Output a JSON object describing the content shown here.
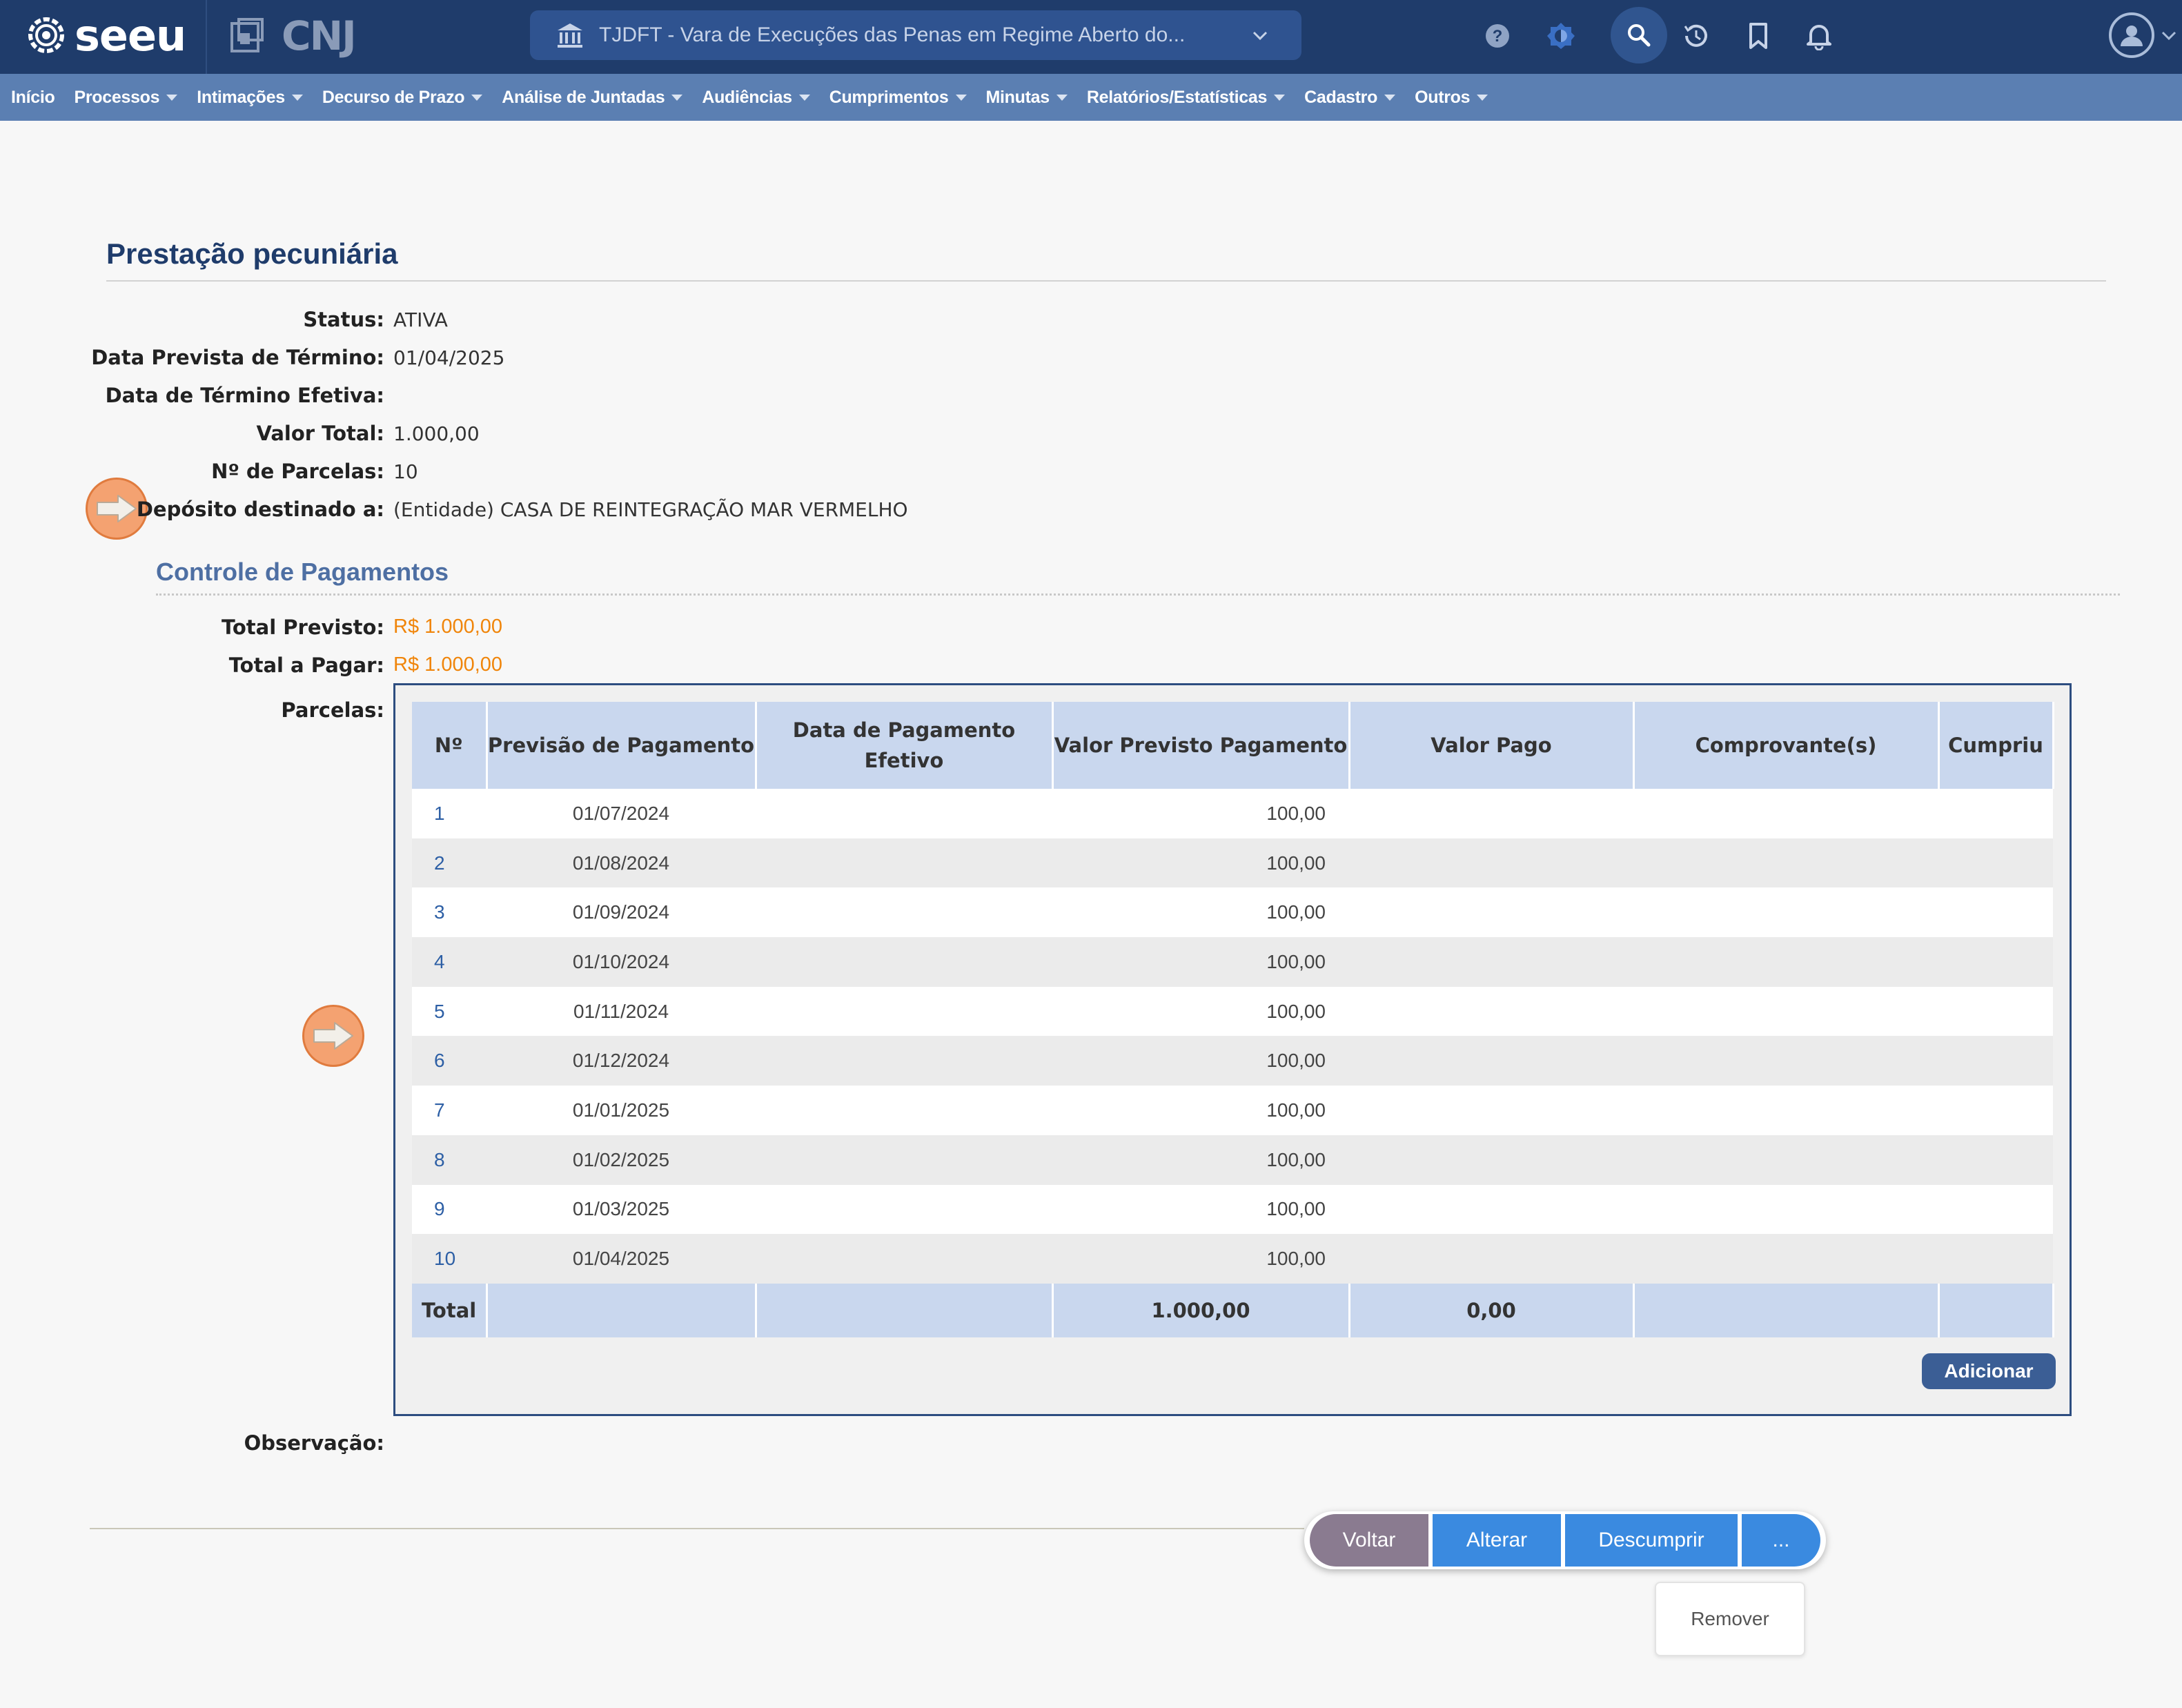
{
  "header": {
    "brand": "seeu",
    "partner_logo": "CNJ",
    "court_selector": "TJDFT - Vara de Execuções das Penas em Regime Aberto do...",
    "icons": [
      "help-icon",
      "theme-icon",
      "search-icon",
      "history-icon",
      "bookmark-icon",
      "bell-icon",
      "user-avatar-icon"
    ]
  },
  "menu": {
    "items": [
      {
        "label": "Início",
        "dropdown": false
      },
      {
        "label": "Processos",
        "dropdown": true
      },
      {
        "label": "Intimações",
        "dropdown": true
      },
      {
        "label": "Decurso de Prazo",
        "dropdown": true
      },
      {
        "label": "Análise de Juntadas",
        "dropdown": true
      },
      {
        "label": "Audiências",
        "dropdown": true
      },
      {
        "label": "Cumprimentos",
        "dropdown": true
      },
      {
        "label": "Minutas",
        "dropdown": true
      },
      {
        "label": "Relatórios/Estatísticas",
        "dropdown": true
      },
      {
        "label": "Cadastro",
        "dropdown": true
      },
      {
        "label": "Outros",
        "dropdown": true
      }
    ]
  },
  "page": {
    "title": "Prestação pecuniária",
    "fields": [
      {
        "label": "Status:",
        "value": "ATIVA"
      },
      {
        "label": "Data Prevista de Término:",
        "value": "01/04/2025"
      },
      {
        "label": "Data de Término Efetiva:",
        "value": ""
      },
      {
        "label": "Valor Total:",
        "value": "1.000,00"
      },
      {
        "label": "Nº de Parcelas:",
        "value": "10"
      },
      {
        "label": "Depósito destinado a:",
        "value": "(Entidade) CASA DE REINTEGRAÇÃO MAR VERMELHO"
      }
    ],
    "section_title": "Controle de Pagamentos",
    "totals": [
      {
        "label": "Total Previsto:",
        "value": "R$ 1.000,00"
      },
      {
        "label": "Total a Pagar:",
        "value": "R$ 1.000,00"
      }
    ],
    "parcelas_label": "Parcelas:",
    "observacao_label": "Observação:"
  },
  "table": {
    "headers": [
      "Nº",
      "Previsão de Pagamento",
      "Data de Pagamento Efetivo",
      "Valor Previsto Pagamento",
      "Valor Pago",
      "Comprovante(s)",
      "Cumpriu"
    ],
    "rows": [
      [
        "1",
        "01/07/2024",
        "",
        "100,00",
        "",
        "",
        ""
      ],
      [
        "2",
        "01/08/2024",
        "",
        "100,00",
        "",
        "",
        ""
      ],
      [
        "3",
        "01/09/2024",
        "",
        "100,00",
        "",
        "",
        ""
      ],
      [
        "4",
        "01/10/2024",
        "",
        "100,00",
        "",
        "",
        ""
      ],
      [
        "5",
        "01/11/2024",
        "",
        "100,00",
        "",
        "",
        ""
      ],
      [
        "6",
        "01/12/2024",
        "",
        "100,00",
        "",
        "",
        ""
      ],
      [
        "7",
        "01/01/2025",
        "",
        "100,00",
        "",
        "",
        ""
      ],
      [
        "8",
        "01/02/2025",
        "",
        "100,00",
        "",
        "",
        ""
      ],
      [
        "9",
        "01/03/2025",
        "",
        "100,00",
        "",
        "",
        ""
      ],
      [
        "10",
        "01/04/2025",
        "",
        "100,00",
        "",
        "",
        ""
      ]
    ],
    "footer": {
      "label": "Total",
      "valor_previsto": "1.000,00",
      "valor_pago": "0,00"
    },
    "add_button": "Adicionar"
  },
  "actions": {
    "voltar": "Voltar",
    "alterar": "Alterar",
    "descumprir": "Descumprir",
    "more": "...",
    "dropdown_items": [
      "Remover"
    ]
  },
  "colors": {
    "topbar": "#1f3c6b",
    "menubar": "#5b7fb2",
    "title": "#1f3c6b",
    "accent_orange": "#f0850a",
    "button_blue": "#3a8ae0",
    "button_voltar": "#8a7b90",
    "table_header": "#c9d7ee",
    "marker": "#f4a271"
  }
}
